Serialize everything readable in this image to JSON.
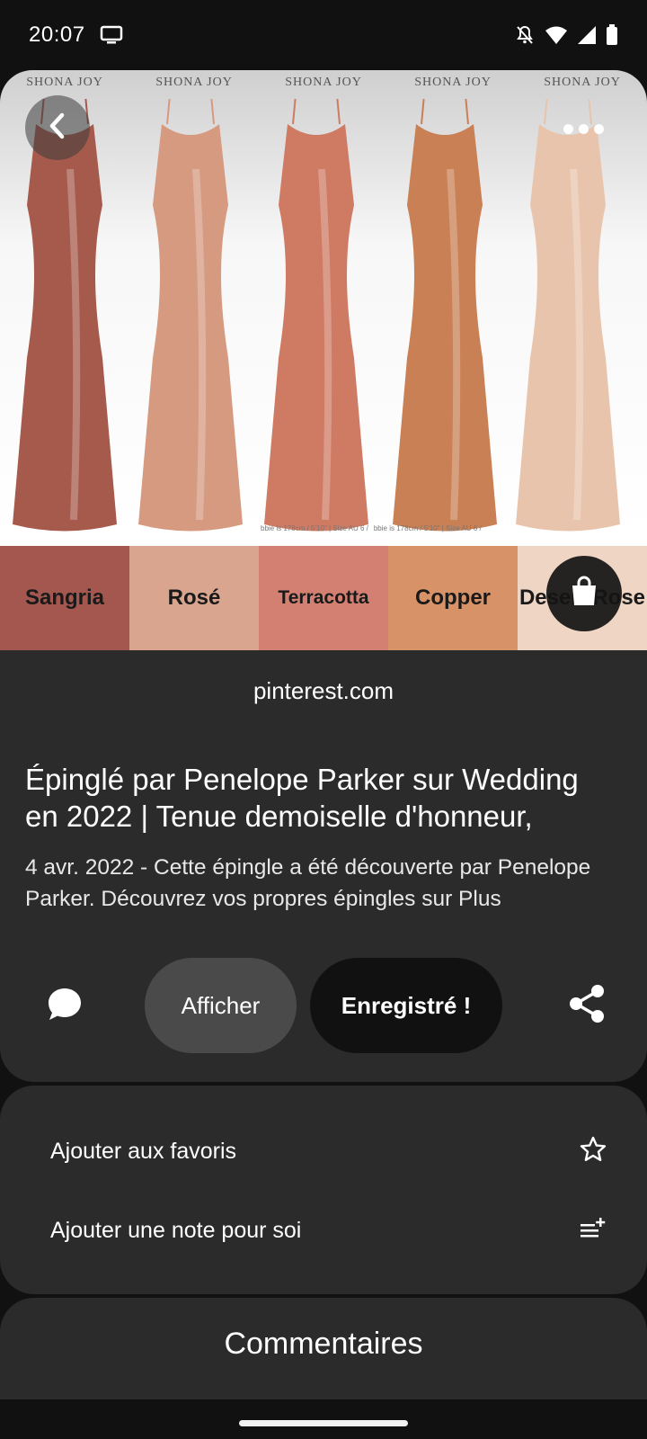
{
  "status_bar": {
    "time": "20:07",
    "icons": [
      "cast-icon",
      "notifications-off-icon",
      "wifi-icon",
      "signal-icon",
      "battery-icon"
    ]
  },
  "pin_image": {
    "brand_labels": [
      "SHONA JOY",
      "SHONA JOY",
      "SHONA JOY",
      "SHONA JOY",
      "SHONA JOY"
    ],
    "size_captions": [
      "bbie is 178cm / 5'10\" | Size AU 6 /",
      "bbie is 178cm / 5'10\" | Size AU 6 /"
    ],
    "swatches": [
      {
        "label": "Sangria",
        "color": "#a4574f"
      },
      {
        "label": "Rosé",
        "color": "#d9a58f"
      },
      {
        "label": "Terracotta",
        "color": "#d37f71"
      },
      {
        "label": "Copper",
        "color": "#d89268"
      },
      {
        "label": "Desert Rose",
        "color": "#efd5c3"
      }
    ],
    "dress_colors": [
      "#a65a4c",
      "#d69a80",
      "#cf7a63",
      "#c98055",
      "#e9c4ac"
    ]
  },
  "source": "pinterest.com",
  "title": "Épinglé par Penelope Parker sur Wedding en 2022 | Tenue demoiselle d'honneur,",
  "description": "4 avr. 2022 - Cette épingle a été découverte par Penelope Parker. Découvrez vos propres épingles sur Plus",
  "actions": {
    "afficher": "Afficher",
    "saved": "Enregistré !"
  },
  "options": [
    {
      "label": "Ajouter aux favoris",
      "icon": "star-outline-icon"
    },
    {
      "label": "Ajouter une note pour soi",
      "icon": "add-note-icon"
    }
  ],
  "comments_title": "Commentaires"
}
